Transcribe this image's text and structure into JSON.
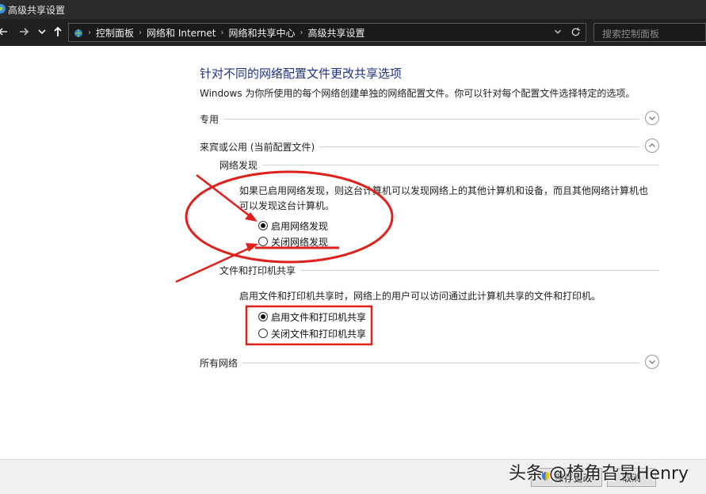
{
  "window": {
    "title": "高级共享设置"
  },
  "nav": {
    "breadcrumbs": [
      "控制面板",
      "网络和 Internet",
      "网络和共享中心",
      "高级共享设置"
    ],
    "search_placeholder": "搜索控制面板"
  },
  "content": {
    "heading": "针对不同的网络配置文件更改共享选项",
    "description": "Windows 为你所使用的每个网络创建单独的网络配置文件。你可以针对每个配置文件选择特定的选项。",
    "sections": {
      "private": {
        "label": "专用",
        "expanded": false
      },
      "guest": {
        "label": "来宾或公用 (当前配置文件)",
        "expanded": true
      },
      "all": {
        "label": "所有网络",
        "expanded": false
      }
    },
    "network_discovery": {
      "title": "网络发现",
      "text_line1": "如果已启用网络发现，则这台计算机可以发现网络上的其他计算机和设备，而且其他网络计算机也",
      "text_line2": "可以发现这台计算机。",
      "options": [
        {
          "label": "启用网络发现",
          "selected": true
        },
        {
          "label": "关闭网络发现",
          "selected": false
        }
      ]
    },
    "file_sharing": {
      "title": "文件和打印机共享",
      "text": "启用文件和打印机共享时，网络上的用户可以访问通过此计算机共享的文件和打印机。",
      "options": [
        {
          "label": "启用文件和打印机共享",
          "selected": true
        },
        {
          "label": "关闭文件和打印机共享",
          "selected": false
        }
      ]
    }
  },
  "footer": {
    "save_label": "保存更改",
    "cancel_label": "取消"
  },
  "watermark": "头条 @椅角旮旯Henry",
  "colors": {
    "annotation_red": "#e0201b",
    "heading_blue": "#1e3287",
    "titlebar": "#2b2b2b"
  },
  "icons": [
    "app-icon",
    "back-arrow-icon",
    "forward-arrow-icon",
    "recent-chevron-icon",
    "up-arrow-icon",
    "network-location-icon",
    "dropdown-chevron-icon",
    "refresh-icon",
    "expand-chevron-icon",
    "collapse-chevron-icon",
    "shield-icon"
  ]
}
